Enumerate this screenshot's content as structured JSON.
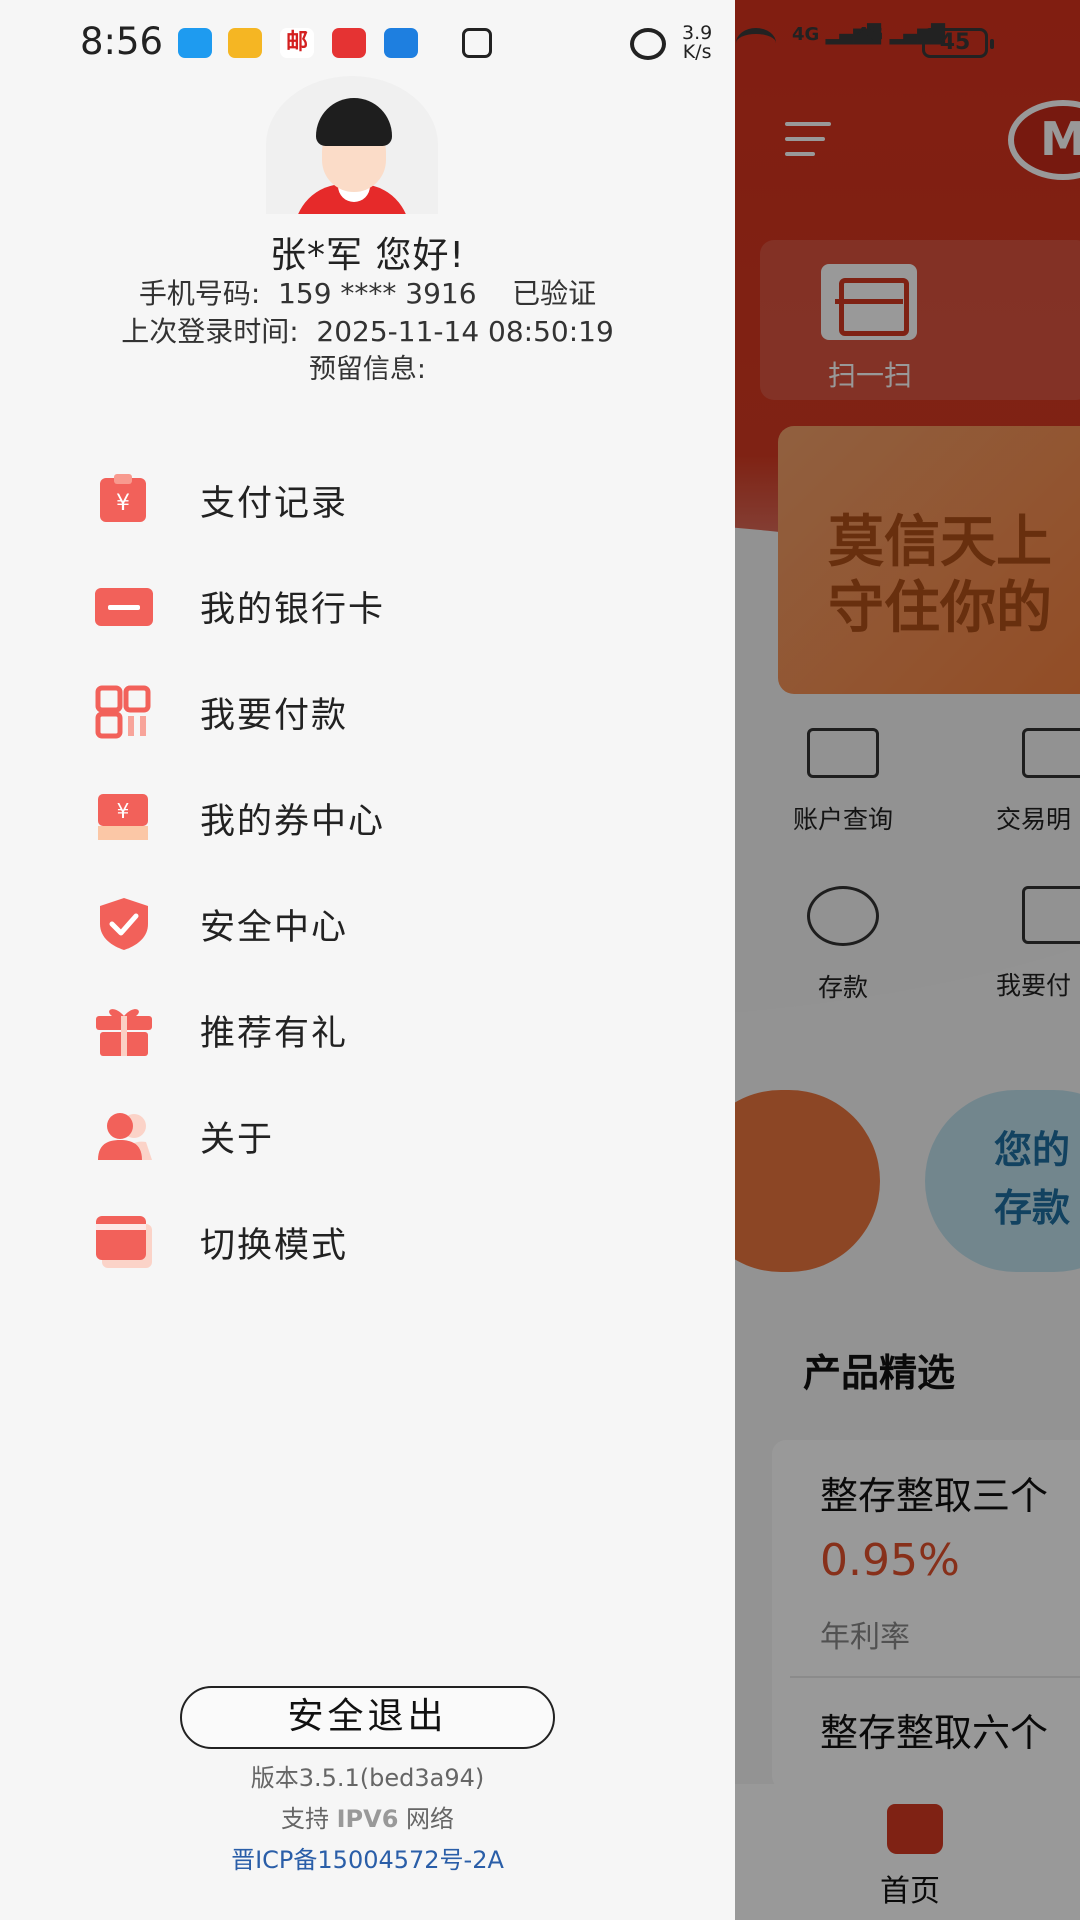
{
  "status_bar": {
    "time": "8:56",
    "speed_value": "3.9",
    "speed_unit": "K/s",
    "net1": "4G",
    "net2": "4G",
    "battery": "45"
  },
  "profile": {
    "greeting": "张*军 您好!",
    "phone": "手机号码:  159 **** 3916    已验证",
    "last_login": "上次登录时间:  2025-11-14 08:50:19",
    "reserved_info": "预留信息:"
  },
  "menu": [
    {
      "label": "支付记录",
      "icon": "payment-record-icon"
    },
    {
      "label": "我的银行卡",
      "icon": "bank-card-icon"
    },
    {
      "label": "我要付款",
      "icon": "qr-pay-icon"
    },
    {
      "label": "我的券中心",
      "icon": "coupon-icon"
    },
    {
      "label": "安全中心",
      "icon": "shield-icon"
    },
    {
      "label": "推荐有礼",
      "icon": "gift-icon"
    },
    {
      "label": "关于",
      "icon": "user-icon"
    },
    {
      "label": "切换模式",
      "icon": "switch-mode-icon"
    }
  ],
  "footer": {
    "logout": "安全退出",
    "version": "版本3.5.1(bed3a94)",
    "ipv6_prefix": "支持 ",
    "ipv6_highlight": "IPV6",
    "ipv6_suffix": " 网络",
    "icp": "晋ICP备15004572号-2A"
  },
  "background": {
    "scan_label": "扫一扫",
    "banner_line1": "莫信天上",
    "banner_line2": "守住你的",
    "grid": [
      "账户查询",
      "交易明",
      "存款",
      "我要付"
    ],
    "pill_line1": "您的",
    "pill_line2": "存款",
    "section_title": "产品精选",
    "product1": "整存整取三个",
    "product1_rate": "0.95%",
    "product1_rate_label": "年利率",
    "product2": "整存整取六个",
    "tab_home": "首页"
  },
  "colors": {
    "accent": "#f2615a",
    "brand_red": "#d43a22",
    "link_blue": "#2a5ea8"
  }
}
